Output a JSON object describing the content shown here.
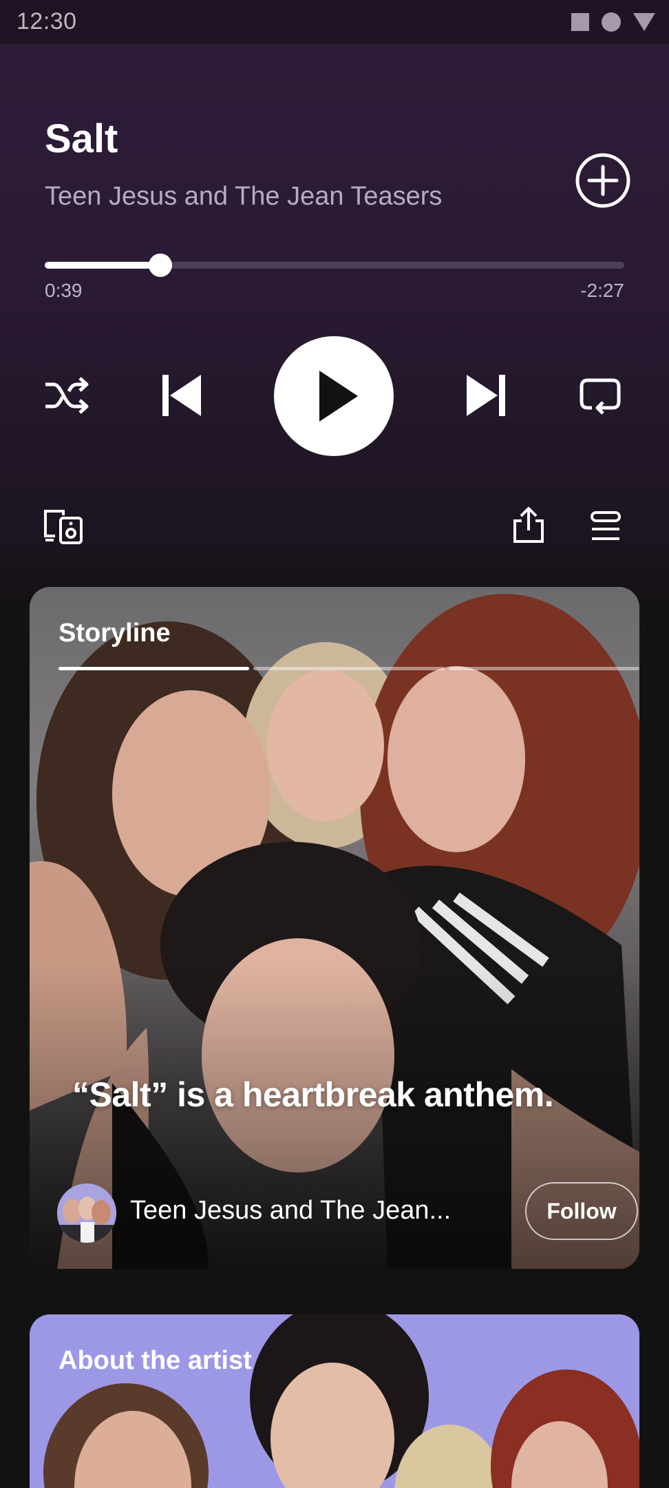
{
  "status_bar": {
    "time": "12:30",
    "icons": [
      "square-icon",
      "circle-icon",
      "triangle-icon"
    ]
  },
  "now_playing": {
    "title": "Salt",
    "artist": "Teen Jesus and The Jean Teasers",
    "add_icon": "add-circle-icon",
    "progress": {
      "elapsed": "0:39",
      "remaining": "-2:27",
      "fraction": 0.2
    }
  },
  "controls": {
    "shuffle": "shuffle-icon",
    "previous": "skip-previous-icon",
    "play": "play-icon",
    "next": "skip-next-icon",
    "repeat": "repeat-icon"
  },
  "actions": {
    "devices": "connect-device-icon",
    "share": "share-icon",
    "queue": "queue-icon"
  },
  "storyline": {
    "label": "Storyline",
    "segments": 3,
    "active_segment": 0,
    "quote": "“Salt” is a heartbreak anthem.",
    "artist_name": "Teen Jesus and The Jean...",
    "follow_label": "Follow"
  },
  "about_artist": {
    "label": "About the artist"
  },
  "colors": {
    "background": "#121212",
    "header_gradient": "#2e1c38",
    "text_secondary": "#b7adbd",
    "about_card": "#9d98e6"
  }
}
